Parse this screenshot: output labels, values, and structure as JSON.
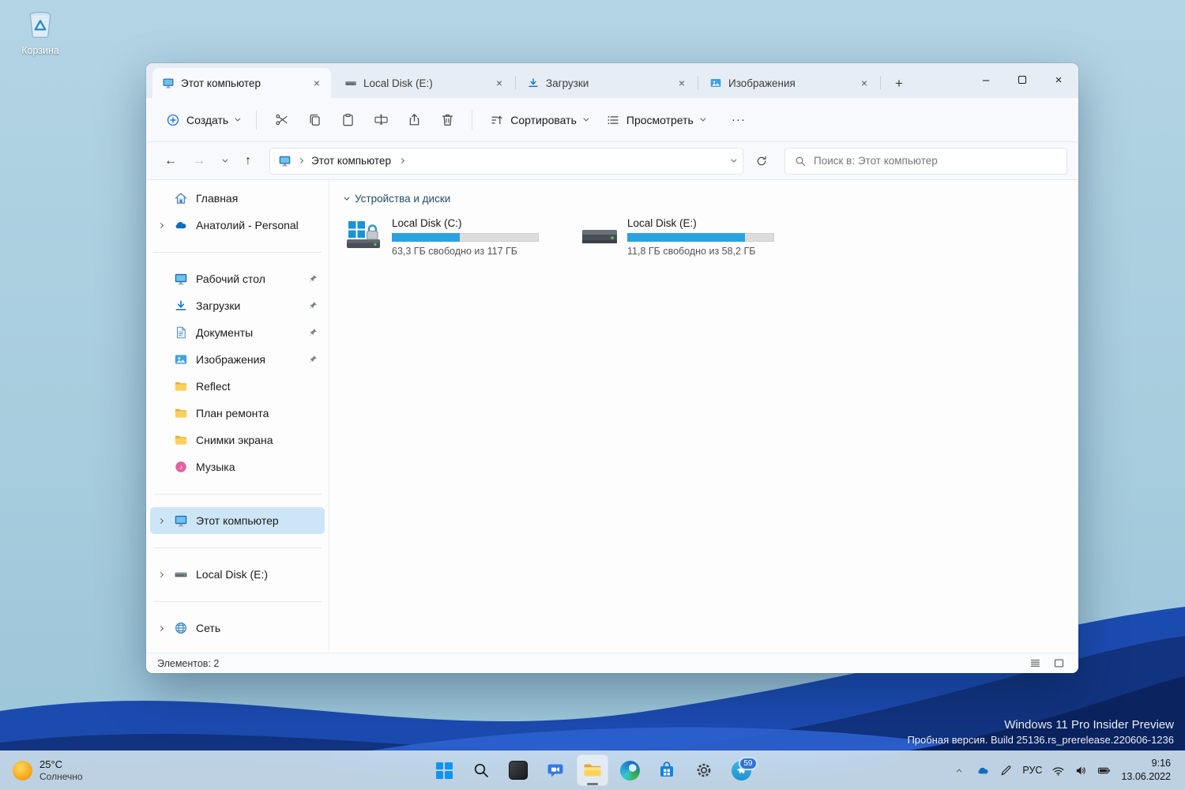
{
  "desktop": {
    "recycle_bin_label": "Корзина",
    "watermark_line1": "Windows 11 Pro Insider Preview",
    "watermark_line2": "Пробная версия. Build 25136.rs_prerelease.220606-1236"
  },
  "icons": {
    "back": "←",
    "forward": "→",
    "up": "↑",
    "minimize": "–",
    "close": "×",
    "new_tab": "+",
    "music_note": "♪"
  },
  "window": {
    "tabs": [
      {
        "label": "Этот компьютер"
      },
      {
        "label": "Local Disk (E:)"
      },
      {
        "label": "Загрузки"
      },
      {
        "label": "Изображения"
      }
    ],
    "toolbar": {
      "create_label": "Создать",
      "sort_label": "Сортировать",
      "view_label": "Просмотреть",
      "more_label": "···"
    },
    "address": {
      "breadcrumb_root": "Этот компьютер",
      "search_placeholder": "Поиск в: Этот компьютер"
    },
    "sidebar": {
      "items": [
        {
          "label": "Главная"
        },
        {
          "label": "Анатолий - Personal"
        },
        {
          "label": "Рабочий стол"
        },
        {
          "label": "Загрузки"
        },
        {
          "label": "Документы"
        },
        {
          "label": "Изображения"
        },
        {
          "label": "Reflect"
        },
        {
          "label": "План ремонта"
        },
        {
          "label": "Снимки экрана"
        },
        {
          "label": "Музыка"
        },
        {
          "label": "Этот компьютер"
        },
        {
          "label": "Local Disk (E:)"
        },
        {
          "label": "Сеть"
        }
      ]
    },
    "content": {
      "group_title": "Устройства и диски",
      "drives": [
        {
          "name": "Local Disk (C:)",
          "free_text": "63,3 ГБ свободно из 117 ГБ",
          "used_percent": 46
        },
        {
          "name": "Local Disk (E:)",
          "free_text": "11,8 ГБ свободно из 58,2 ГБ",
          "used_percent": 80
        }
      ]
    },
    "statusbar": {
      "items_count": "Элементов: 2"
    }
  },
  "taskbar": {
    "weather": {
      "temperature": "25°C",
      "condition": "Солнечно"
    },
    "notification_badge": "59",
    "tray": {
      "language": "РУС",
      "time": "9:16",
      "date": "13.06.2022"
    }
  },
  "colors": {
    "accent": "#0067c0",
    "progress_fill": "#2ba2e0",
    "sidebar_selection": "#cde6f7"
  }
}
